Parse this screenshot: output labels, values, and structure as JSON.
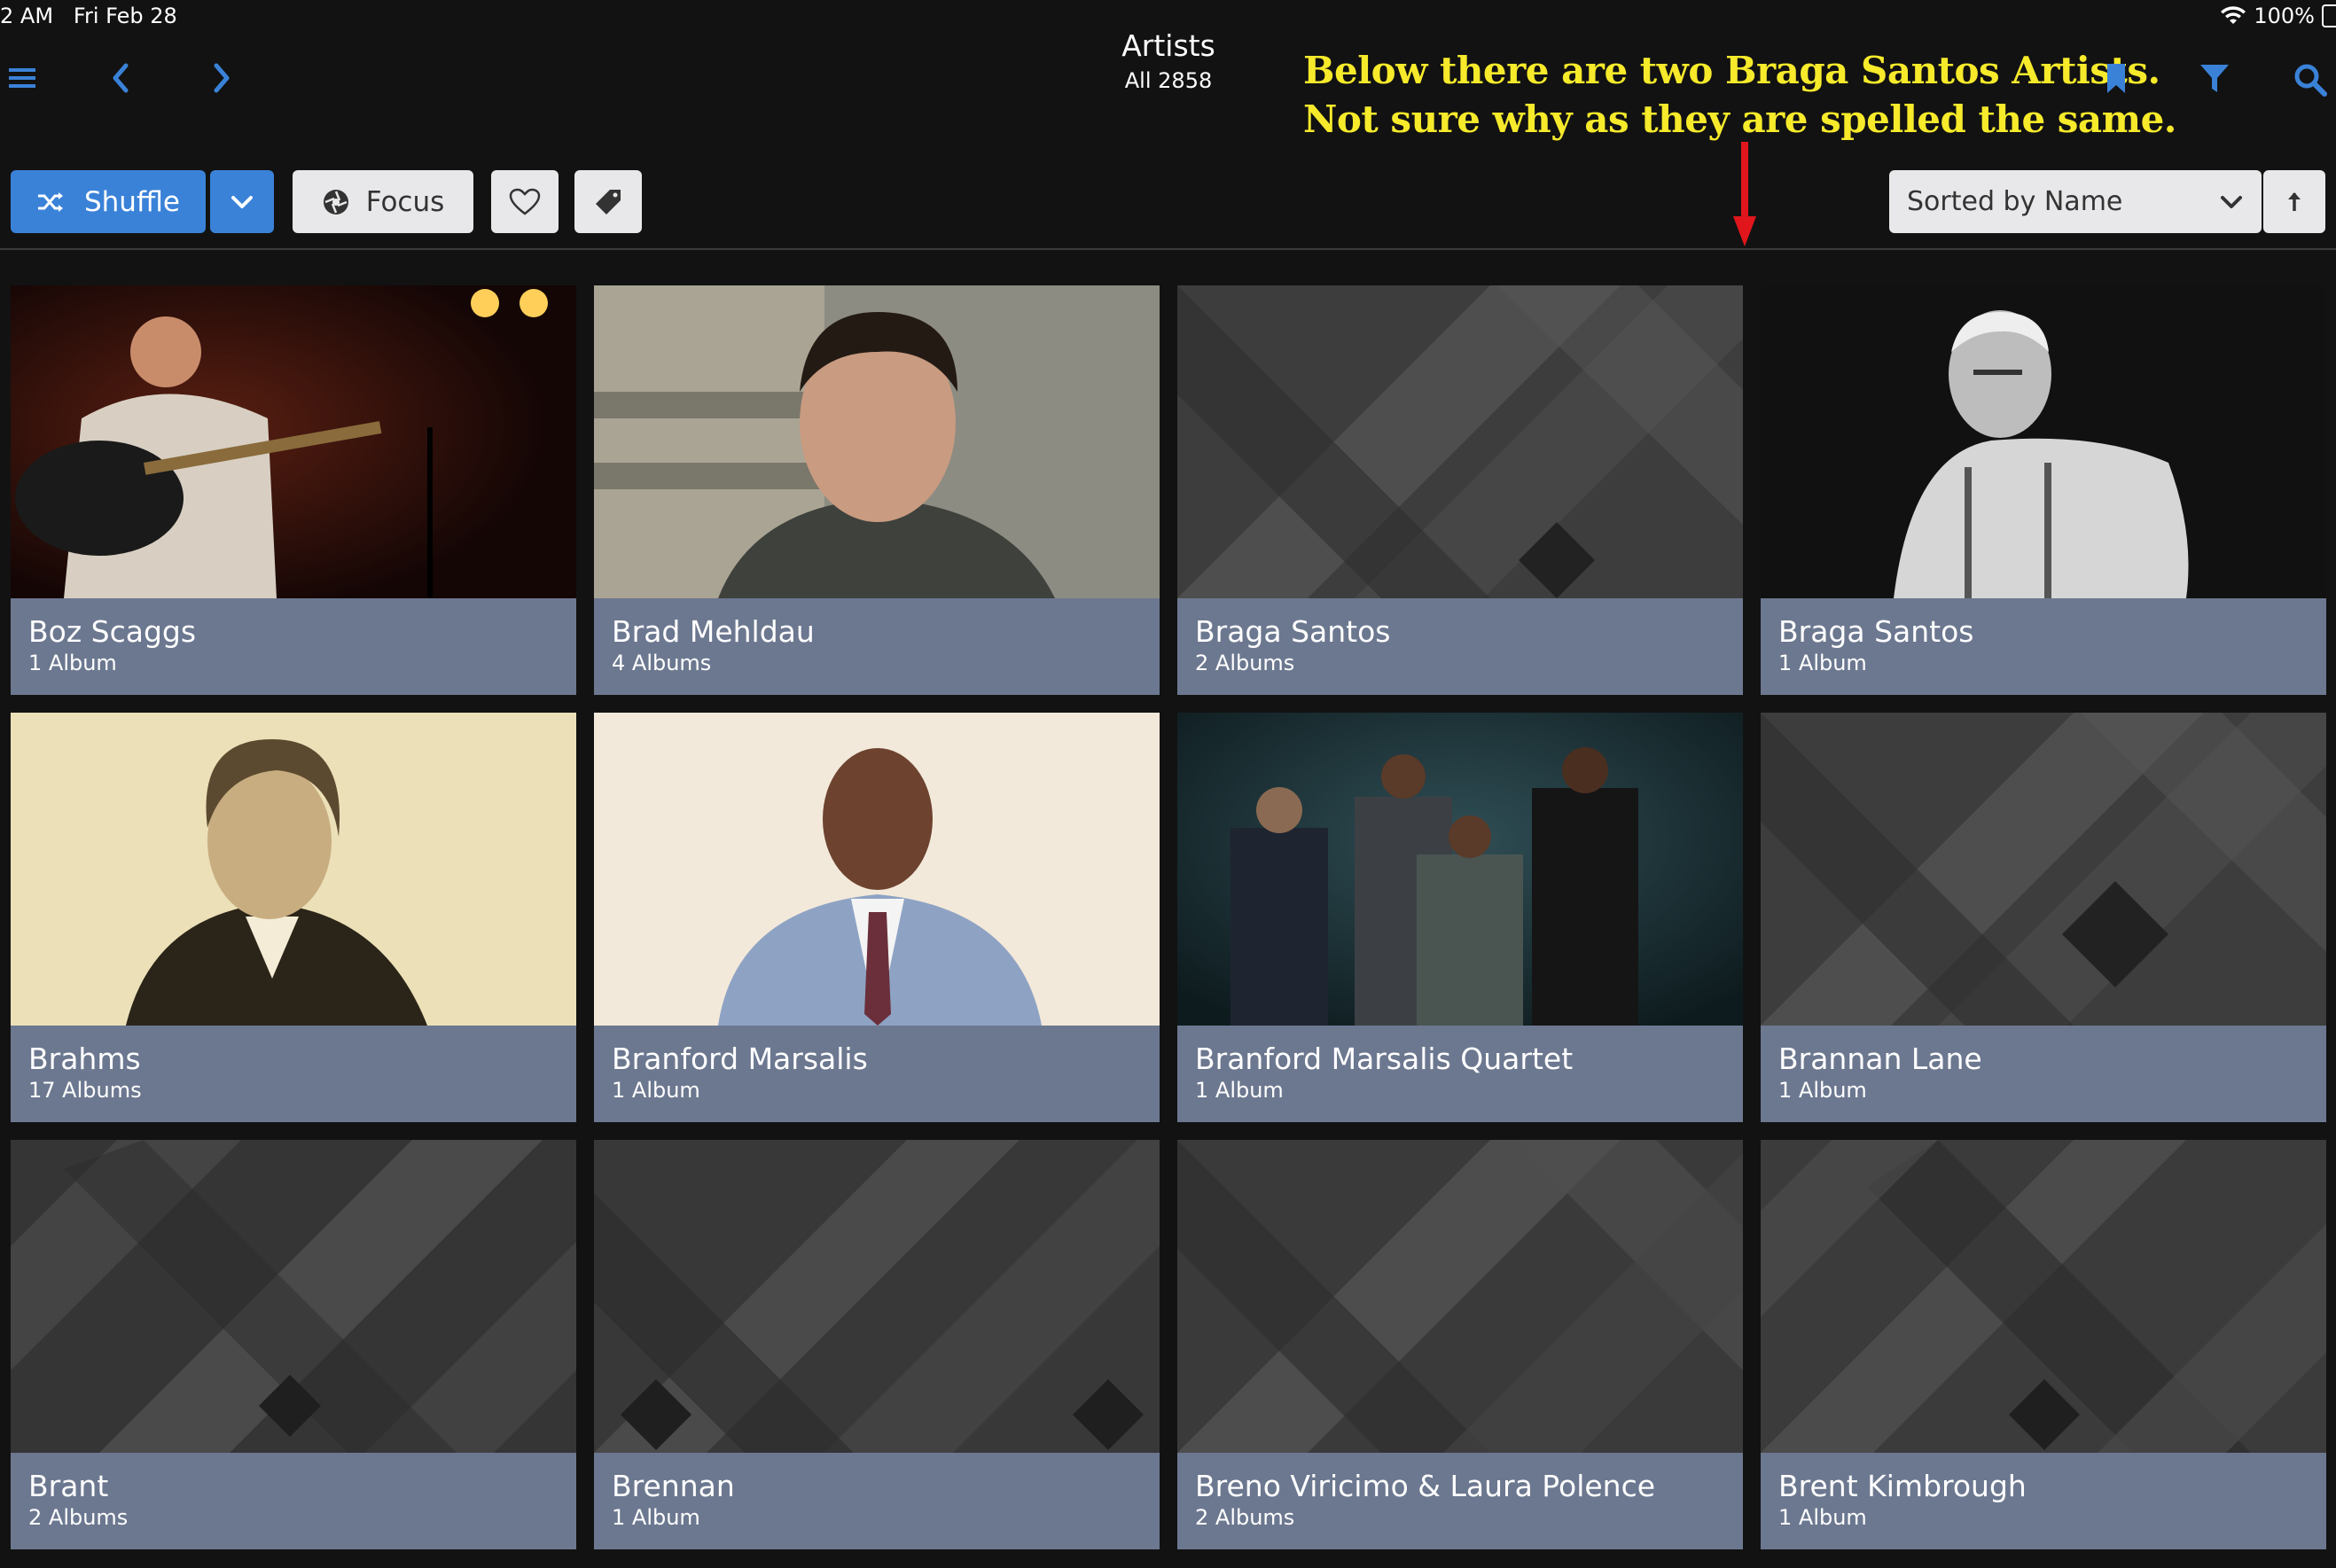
{
  "status": {
    "time": "2 AM",
    "date": "Fri Feb 28",
    "battery": "100%"
  },
  "header": {
    "title": "Artists",
    "subtitle": "All 2858"
  },
  "annotation": {
    "line1": "Below there are two Braga Santos Artists.",
    "line2": "Not sure why as they are spelled the same.",
    "color": "#f6ea2b",
    "arrow_color": "#e0161c"
  },
  "toolbar": {
    "shuffle_label": "Shuffle",
    "focus_label": "Focus",
    "sort_label": "Sorted by Name"
  },
  "colors": {
    "accent": "#3a82d8",
    "caption_bg": "#6c7890",
    "background": "#121212"
  },
  "artists": [
    {
      "name": "Boz Scaggs",
      "count": "1 Album",
      "art": "photo-guitarist"
    },
    {
      "name": "Brad Mehldau",
      "count": "4 Albums",
      "art": "photo-portrait"
    },
    {
      "name": "Braga Santos",
      "count": "2 Albums",
      "art": "placeholder"
    },
    {
      "name": "Braga Santos",
      "count": "1 Album",
      "art": "photo-bw-man"
    },
    {
      "name": "Brahms",
      "count": "17 Albums",
      "art": "photo-sepia"
    },
    {
      "name": "Branford Marsalis",
      "count": "1 Album",
      "art": "photo-suit"
    },
    {
      "name": "Branford Marsalis Quartet",
      "count": "1 Album",
      "art": "photo-quartet"
    },
    {
      "name": "Brannan Lane",
      "count": "1 Album",
      "art": "placeholder"
    },
    {
      "name": "Brant",
      "count": "2 Albums",
      "art": "placeholder"
    },
    {
      "name": "Brennan",
      "count": "1 Album",
      "art": "placeholder"
    },
    {
      "name": "Breno Viricimo & Laura Polence",
      "count": "2 Albums",
      "art": "placeholder"
    },
    {
      "name": "Brent Kimbrough",
      "count": "1 Album",
      "art": "placeholder"
    }
  ]
}
